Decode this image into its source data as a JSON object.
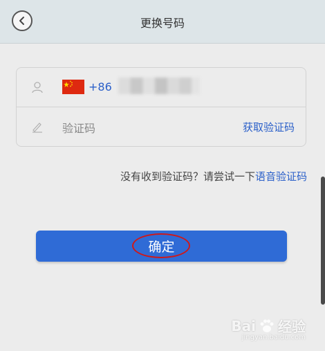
{
  "header": {
    "title": "更换号码",
    "back_icon": "chevron-left-icon"
  },
  "form": {
    "phone": {
      "icon": "user-icon",
      "flag": "china-flag-icon",
      "country_code": "+86"
    },
    "code": {
      "icon": "pencil-icon",
      "placeholder": "验证码",
      "get_code_label": "获取验证码"
    }
  },
  "hint": {
    "text": "没有收到验证码？请尝试一下",
    "link": "语音验证码"
  },
  "confirm_button": {
    "label": "确定",
    "color": "#2f6bd6"
  },
  "watermark": {
    "brand": "Bai",
    "brand2": "经验",
    "url": "jingyan.baidu.com"
  },
  "colors": {
    "accent": "#2a5fc9",
    "annotation": "#d01818",
    "header_bg": "#dde5e8"
  }
}
